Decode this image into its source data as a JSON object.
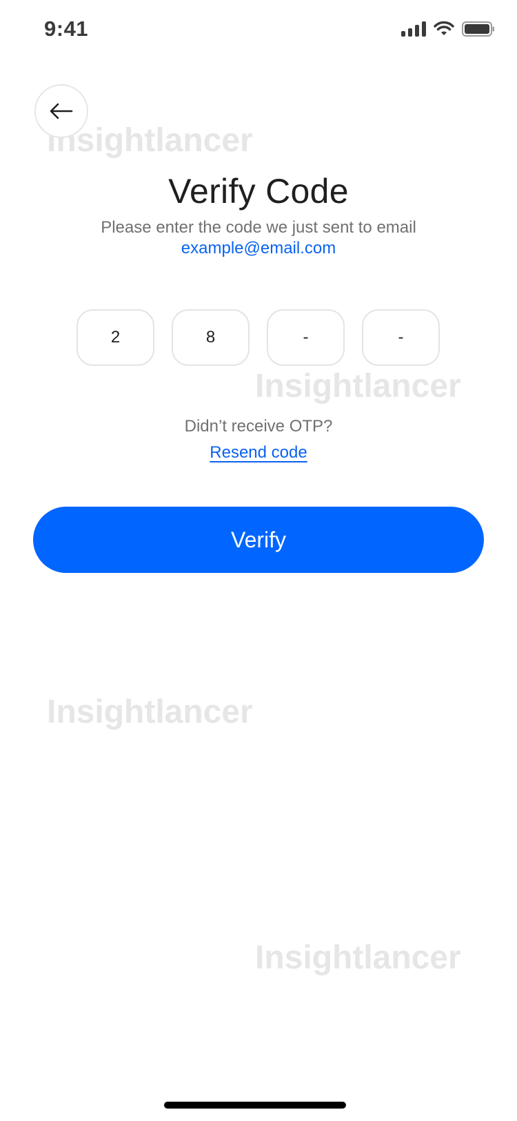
{
  "status_bar": {
    "time": "9:41",
    "icons": [
      "cellular-signal-icon",
      "wifi-icon",
      "battery-icon"
    ]
  },
  "watermark": "Insightlancer",
  "back_button": {
    "icon": "arrow-left-icon"
  },
  "title": "Verify Code",
  "subtitle": "Please enter the code we just sent to email",
  "email": "example@email.com",
  "otp": {
    "digits": [
      "2",
      "8",
      "-",
      "-"
    ]
  },
  "resend": {
    "prompt": "Didn’t receive OTP?",
    "link": "Resend code"
  },
  "verify_button": {
    "label": "Verify"
  },
  "colors": {
    "accent": "#0066ff",
    "link": "#0a63f0",
    "muted_text": "#707070",
    "border": "#e4e4e4"
  }
}
